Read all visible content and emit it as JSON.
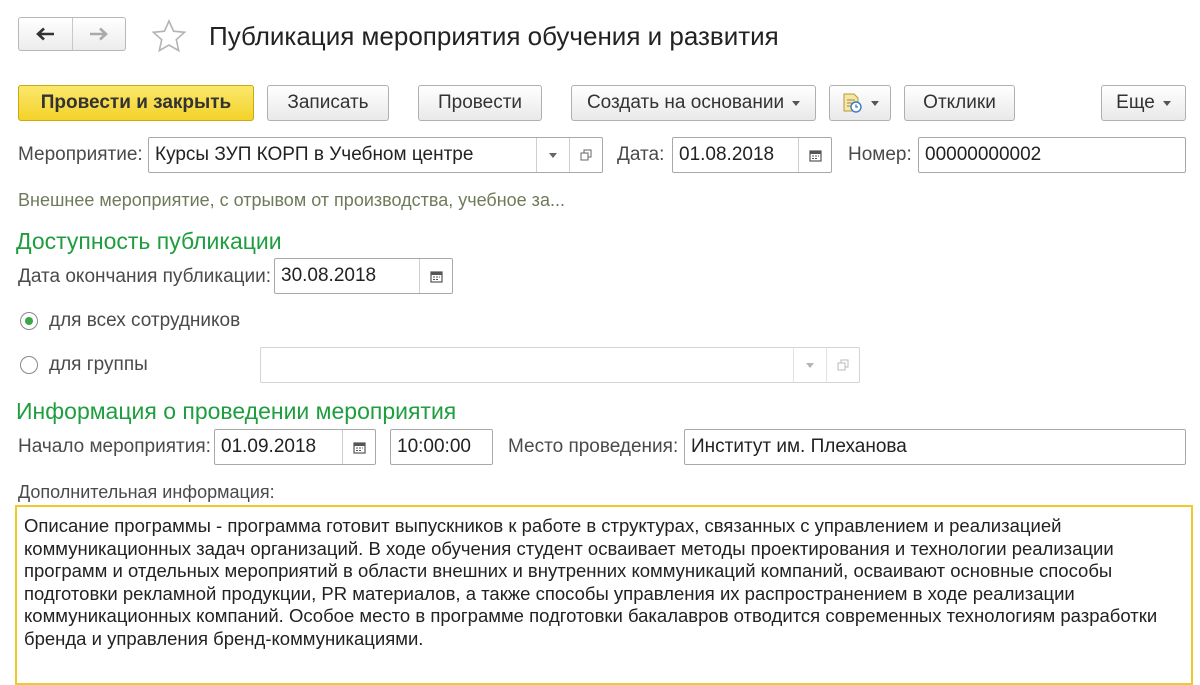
{
  "window": {
    "title": "Публикация мероприятия обучения и развития",
    "nav": {
      "back_icon": "arrow-left-icon",
      "forward_icon": "arrow-right-icon"
    },
    "favorite_icon": "star-icon"
  },
  "toolbar": {
    "post_and_close": "Провести и закрыть",
    "save": "Записать",
    "post": "Провести",
    "create_based_on": "Создать на основании",
    "report_icon": "document-clock-icon",
    "responses": "Отклики",
    "more": "Еще"
  },
  "header": {
    "event_label": "Мероприятие:",
    "event_value": "Курсы ЗУП КОРП в Учебном центре",
    "date_label": "Дата:",
    "date_value": "01.08.2018",
    "number_label": "Номер:",
    "number_value": "00000000002",
    "event_description": "Внешнее мероприятие, с отрывом от производства, учебное за..."
  },
  "availability": {
    "heading": "Доступность публикации",
    "end_date_label": "Дата окончания публикации:",
    "end_date_value": "30.08.2018",
    "all_employees_label": "для всех сотрудников",
    "group_label": "для группы",
    "group_value": "",
    "selected": "all_employees"
  },
  "event_info": {
    "heading": "Информация о проведении мероприятия",
    "start_label": "Начало мероприятия:",
    "start_date": "01.09.2018",
    "start_time": "10:00:00",
    "place_label": "Место проведения:",
    "place_value": "Институт им. Плеханова",
    "additional_label": "Дополнительная информация:",
    "additional_text": "Описание программы - программа готовит выпускников к работе в структурах, связанных с управлением и реализацией коммуникационных задач организаций. В ходе обучения студент осваивает методы проектирования и технологии реализации программ и отдельных мероприятий в области внешних и внутренних коммуникаций компаний, осваивают основные способы подготовки рекламной продукции, PR материалов, а также способы управления их распространением в ходе реализации коммуникационных компаний. Особое место в программе подготовки бакалавров отводится современных технологиям разработки бренда и управления бренд-коммуникациями."
  },
  "colors": {
    "accent_green": "#1e9e3e",
    "primary_button": "#f3d22a",
    "focus_border": "#f0c92a"
  }
}
